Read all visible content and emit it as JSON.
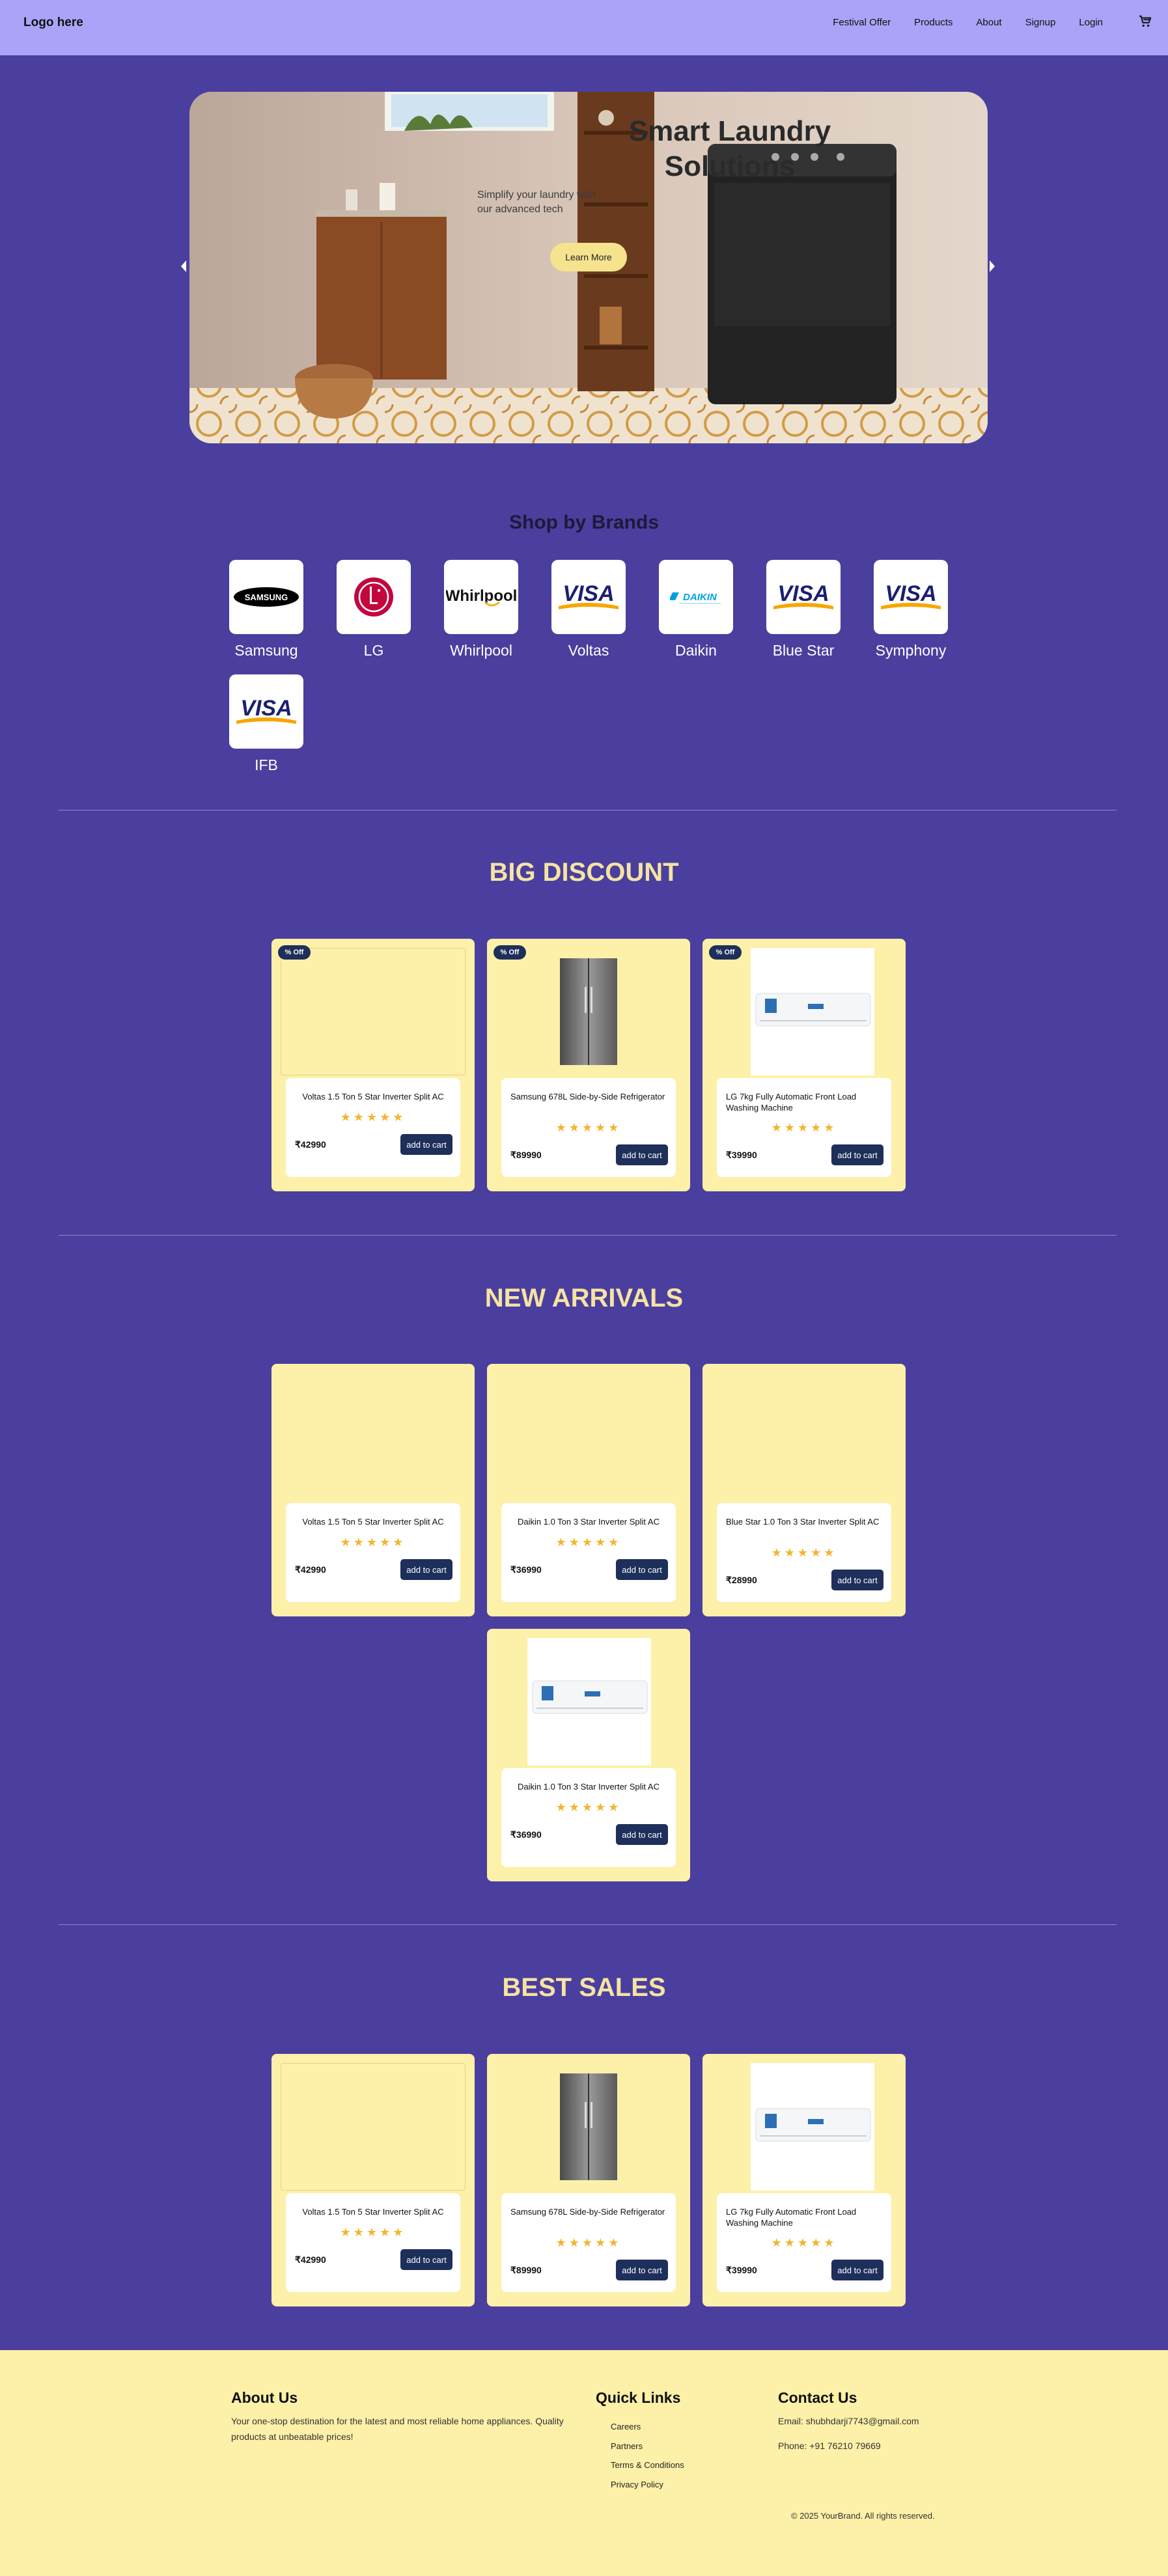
{
  "nav": {
    "logo": "Logo here",
    "links": [
      "Festival Offer",
      "Products",
      "About",
      "Signup",
      "Login"
    ],
    "cart_icon": "cart-icon"
  },
  "hero": {
    "title": "Smart Laundry Solutions",
    "subtitle": "Simplify your laundry with our advanced tech",
    "button": "Learn More"
  },
  "brands": {
    "title": "Shop by Brands",
    "items": [
      "Samsung",
      "LG",
      "Whirlpool",
      "Voltas",
      "Daikin",
      "Blue Star",
      "Symphony",
      "IFB"
    ],
    "logo_texts": {
      "samsung": "SAMSUNG",
      "whirlpool": "Whirlpool",
      "visa": "VISA",
      "daikin": "DAIKIN"
    }
  },
  "big_discount": {
    "title": "BIG DISCOUNT",
    "badge": "% Off",
    "products": [
      {
        "name": "Voltas 1.5 Ton 5 Star Inverter Split AC",
        "price": "₹42990"
      },
      {
        "name": "Samsung 678L Side-by-Side Refrigerator",
        "price": "₹89990"
      },
      {
        "name": "LG 7kg Fully Automatic Front Load Washing Machine",
        "price": "₹39990"
      }
    ]
  },
  "new_arrivals": {
    "title": "NEW ARRIVALS",
    "products": [
      {
        "name": "Voltas 1.5 Ton 5 Star Inverter Split AC",
        "price": "₹42990"
      },
      {
        "name": "Daikin 1.0 Ton 3 Star Inverter Split AC",
        "price": "₹36990"
      },
      {
        "name": "Blue Star 1.0 Ton 3 Star Inverter Split AC",
        "price": "₹28990"
      },
      {
        "name": "Daikin 1.0 Ton 3 Star Inverter Split AC",
        "price": "₹36990"
      }
    ]
  },
  "best_sales": {
    "title": "BEST SALES",
    "products": [
      {
        "name": "Voltas 1.5 Ton 5 Star Inverter Split AC",
        "price": "₹42990"
      },
      {
        "name": "Samsung 678L Side-by-Side Refrigerator",
        "price": "₹89990"
      },
      {
        "name": "LG 7kg Fully Automatic Front Load Washing Machine",
        "price": "₹39990"
      }
    ]
  },
  "card_common": {
    "stars": "★★★★★",
    "add_to_cart": "add to cart"
  },
  "footer": {
    "about_title": "About Us",
    "about_text": "Your one-stop destination for the latest and most reliable home appliances. Quality products at unbeatable prices!",
    "links_title": "Quick Links",
    "links": [
      "Careers",
      "Partners",
      "Terms & Conditions",
      "Privacy Policy"
    ],
    "contact_title": "Contact Us",
    "email": "Email: shubhdarji7743@gmail.com",
    "phone": "Phone: +91 76210 79669",
    "copyright": "© 2025 YourBrand. All rights reserved."
  },
  "colors": {
    "background": "#4a3f9e",
    "nav": "#aba3f7",
    "card": "#fdf0a8",
    "button": "#1d2f5a",
    "accent_title": "#f5e3a3",
    "star": "#f3b52f"
  }
}
